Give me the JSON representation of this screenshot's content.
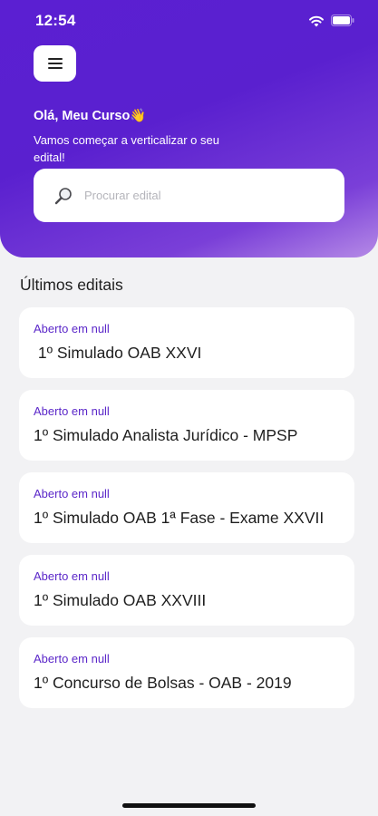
{
  "status_bar": {
    "time": "12:54"
  },
  "header": {
    "greeting": "Olá, Meu Curso👋",
    "subtitle": "Vamos começar a verticalizar o seu edital!",
    "search": {
      "placeholder": "Procurar edital",
      "value": ""
    }
  },
  "section": {
    "title": "Últimos editais"
  },
  "editais": [
    {
      "status": "Aberto em null",
      "title": " 1º Simulado OAB XXVI"
    },
    {
      "status": "Aberto em null",
      "title": "1º Simulado Analista Jurídico - MPSP"
    },
    {
      "status": "Aberto em null",
      "title": "1º Simulado OAB 1ª Fase - Exame XXVII"
    },
    {
      "status": "Aberto em null",
      "title": "1º Simulado OAB XXVIII"
    },
    {
      "status": "Aberto em null",
      "title": "1º Concurso de Bolsas - OAB - 2019"
    }
  ],
  "colors": {
    "accent": "#5b27c9",
    "header_gradient_start": "#5b1fd2",
    "header_gradient_end": "#b58ae6"
  },
  "icons": {
    "menu": "hamburger-icon",
    "search": "search-icon",
    "wifi": "wifi-icon",
    "battery": "battery-icon"
  }
}
